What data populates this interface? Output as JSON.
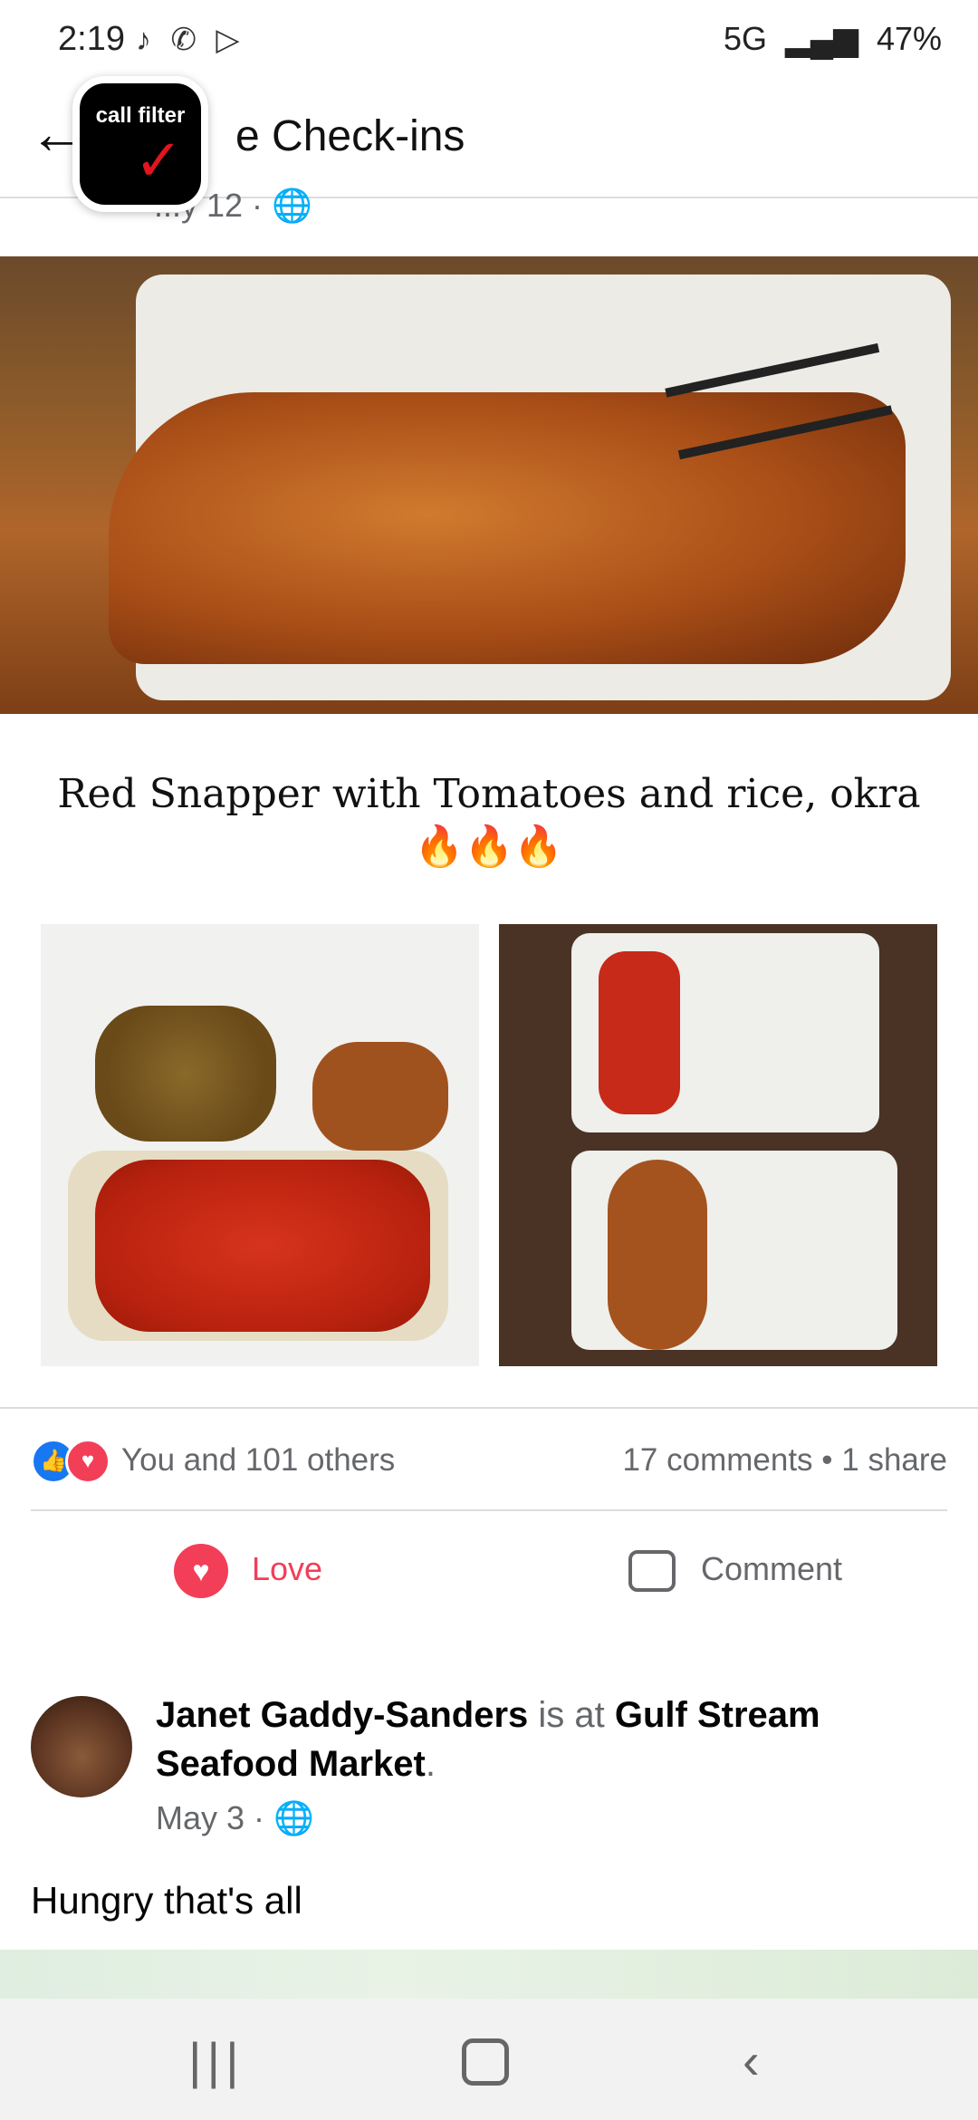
{
  "status_bar": {
    "time": "2:19",
    "left_icons": "♪ ✆ ▷",
    "network": "5G",
    "signal": "▂▄▆",
    "battery": "47%"
  },
  "header": {
    "title": "e Check-ins",
    "back_icon": "←",
    "overlay_app": "call filter",
    "overlay_check": "✓",
    "meta": "...y 12 · 🌐"
  },
  "post1": {
    "caption": "Red Snapper with Tomatoes and rice, okra🔥🔥🔥",
    "reactions_text": "You and 101 others",
    "counts_text": "17 comments • 1 share",
    "love_label": "Love",
    "comment_label": "Comment",
    "like_icon": "👍",
    "heart_icon": "♥"
  },
  "post2": {
    "author": "Janet Gaddy-Sanders",
    "connector": "is at",
    "place": "Gulf Stream Seafood Market",
    "suffix": ".",
    "date": "May 3 · 🌐",
    "text": "Hungry that's all"
  },
  "nav": {
    "recent": "|||",
    "back": "‹"
  },
  "colors": {
    "reaction_heart": "#f33e58",
    "like_blue": "#1877f2",
    "muted_text": "#65676b"
  }
}
